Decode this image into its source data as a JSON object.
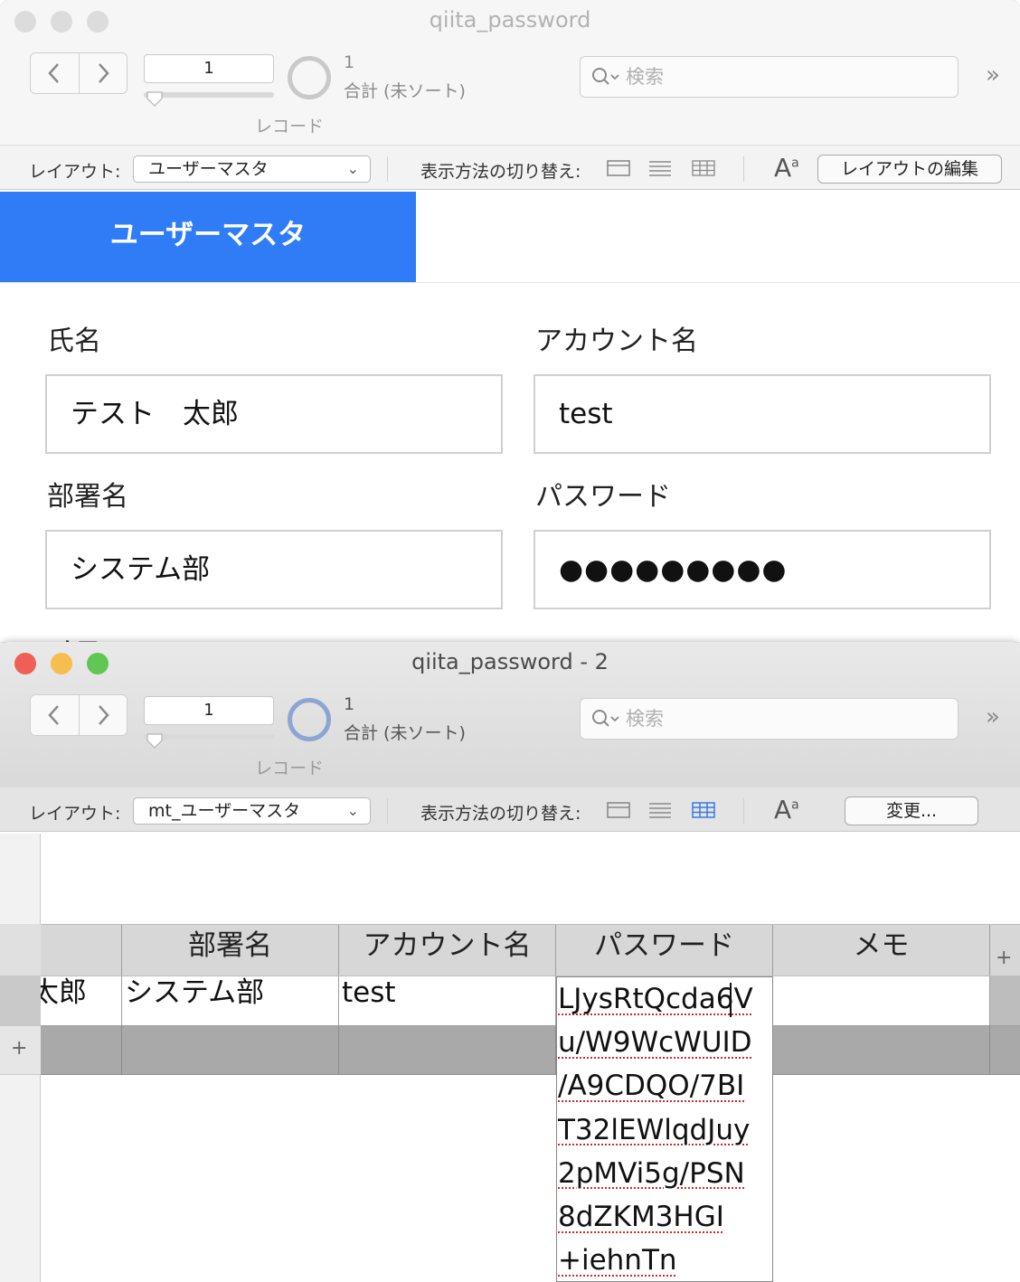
{
  "window1": {
    "title": "qiita_password",
    "record_number": "1",
    "record_count": "1",
    "total_label": "合計 (未ソート)",
    "record_label": "レコード",
    "search_placeholder": "検索",
    "more": "»",
    "layout_label": "レイアウト:",
    "layout_value": "ユーザーマスタ",
    "view_label": "表示方法の切り替え:",
    "aa": "A",
    "aa_small": "a",
    "edit_button": "レイアウトの編集",
    "banner": "ユーザーマスタ",
    "fields": {
      "name_label": "氏名",
      "name_value": "テスト　太郎",
      "account_label": "アカウント名",
      "account_value": "test",
      "dept_label": "部署名",
      "dept_value": "システム部",
      "password_label": "パスワード",
      "password_value": "●●●●●●●●●",
      "memo_label": "メモ"
    }
  },
  "window2": {
    "title": "qiita_password - 2",
    "record_number": "1",
    "record_count": "1",
    "total_label": "合計 (未ソート)",
    "record_label": "レコード",
    "search_placeholder": "検索",
    "more": "»",
    "layout_label": "レイアウト:",
    "layout_value": "mt_ユーザーマスタ",
    "view_label": "表示方法の切り替え:",
    "aa": "A",
    "aa_small": "a",
    "edit_button": "変更...",
    "table": {
      "headers": [
        "部署名",
        "アカウント名",
        "パスワード",
        "メモ"
      ],
      "row": {
        "name_partial": "太郎",
        "dept": "システム部",
        "account": "test",
        "memo": ""
      },
      "password_lines": [
        "LJysRtQcda6V",
        "u/W9WcWUID",
        "/A9CDQO/7BI",
        "T32lEWlqdJuy",
        "2pMVi5g/PSN",
        "8dZKM3HGI",
        "+iehnTn"
      ]
    }
  },
  "colors": {
    "banner": "#2f7cf6",
    "close": "#ed5f57",
    "minimize": "#f5be4f",
    "zoom": "#62c655",
    "inactive_light": "#dcdcdc",
    "table_view_active": "#3a7be0"
  },
  "icons": [
    "chevron-left-icon",
    "chevron-right-icon",
    "search-icon",
    "form-view-icon",
    "list-view-icon",
    "table-view-icon",
    "text-format-icon",
    "add-field-icon",
    "add-record-icon"
  ]
}
